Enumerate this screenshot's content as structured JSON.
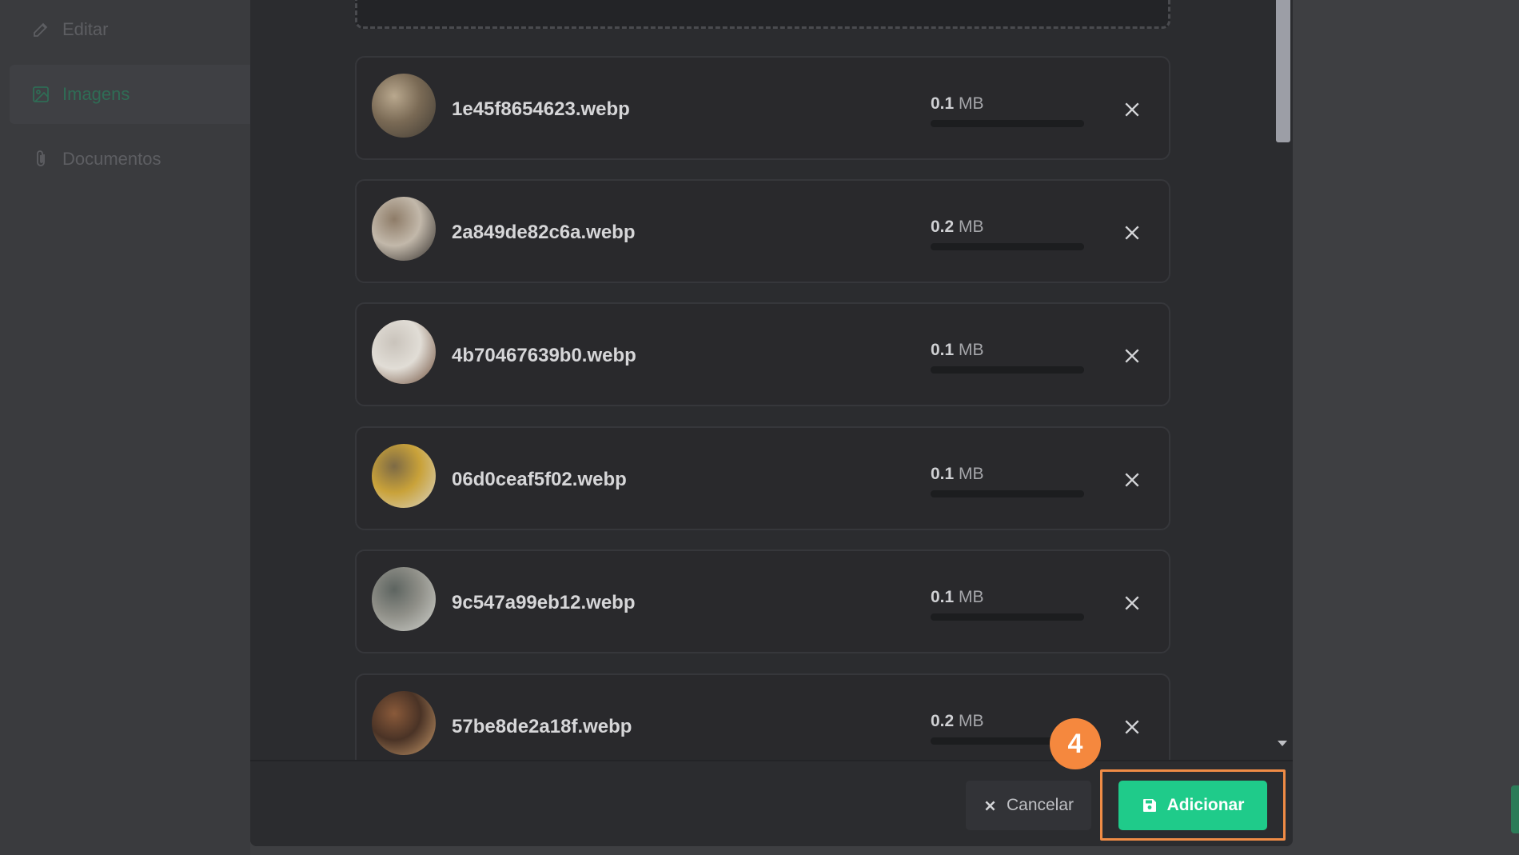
{
  "sidebar": {
    "items": [
      {
        "label": "Editar",
        "icon": "pencil-icon"
      },
      {
        "label": "Imagens",
        "icon": "image-icon",
        "active": true
      },
      {
        "label": "Documentos",
        "icon": "paperclip-icon"
      }
    ]
  },
  "files": [
    {
      "name": "1e45f8654623.webp",
      "size_value": "0.1",
      "size_unit": "MB",
      "thumb_colors": [
        "#b9a88e",
        "#3f3a33",
        "#7a6a55"
      ]
    },
    {
      "name": "2a849de82c6a.webp",
      "size_value": "0.2",
      "size_unit": "MB",
      "thumb_colors": [
        "#8e7c68",
        "#2e2a27",
        "#c2b8aa"
      ]
    },
    {
      "name": "4b70467639b0.webp",
      "size_value": "0.1",
      "size_unit": "MB",
      "thumb_colors": [
        "#c9c3bb",
        "#6b4a36",
        "#e1ddd6"
      ]
    },
    {
      "name": "06d0ceaf5f02.webp",
      "size_value": "0.1",
      "size_unit": "MB",
      "thumb_colors": [
        "#7d6a45",
        "#d9d4c5",
        "#c9a23a"
      ]
    },
    {
      "name": "9c547a99eb12.webp",
      "size_value": "0.1",
      "size_unit": "MB",
      "thumb_colors": [
        "#5d6460",
        "#cfd1cc",
        "#8f8f88"
      ]
    },
    {
      "name": "57be8de2a18f.webp",
      "size_value": "0.2",
      "size_unit": "MB",
      "thumb_colors": [
        "#8a5a3a",
        "#c89a6a",
        "#4a3326"
      ]
    }
  ],
  "footer": {
    "cancel_label": "Cancelar",
    "add_label": "Adicionar"
  },
  "annotation": {
    "step_number": "4"
  },
  "colors": {
    "accent": "#1fcb8a",
    "highlight": "#f08c46",
    "badge": "#f5883e"
  }
}
